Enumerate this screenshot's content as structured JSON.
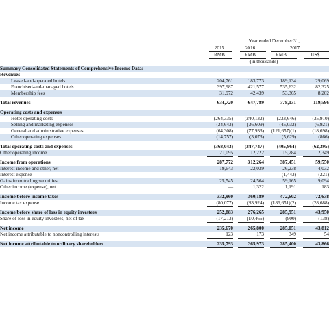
{
  "header": {
    "year_ended": "Year ended December 31,",
    "years": [
      "2015",
      "2016",
      "2017"
    ],
    "currencies": [
      "RMB",
      "RMB",
      "RMB",
      "US$"
    ],
    "units": "(in thousands)"
  },
  "rows": [
    {
      "label": "Summary Consolidated Statements of Comprehensive Income Data:",
      "bold": true
    },
    {
      "label": "Revenues",
      "bold": true
    },
    {
      "label": "Leased-and-operated hotels",
      "indent": 1,
      "values": [
        "204,761",
        "183,773",
        "189,134",
        "29,069"
      ]
    },
    {
      "label": "Franchised-and-managed hotels",
      "indent": 1,
      "values": [
        "397,987",
        "421,577",
        "535,632",
        "82,325"
      ]
    },
    {
      "label": "Membership fees",
      "indent": 1,
      "values": [
        "31,972",
        "42,439",
        "53,365",
        "8,202"
      ],
      "underline": true
    },
    {
      "label": "Total revenues",
      "bold": true,
      "values": [
        "634,720",
        "647,789",
        "778,131",
        "119,596"
      ],
      "gap": true
    },
    {
      "label": "Operating costs and expenses",
      "bold": true,
      "gap": true
    },
    {
      "label": "Hotel operating costs",
      "indent": 1,
      "values": [
        "(264,335)",
        "(240,132)",
        "(233,646)",
        "(35,910)"
      ]
    },
    {
      "label": "Selling and marketing expenses",
      "indent": 1,
      "values": [
        "(24,643)",
        "(26,609)",
        "(45,032)",
        "(6,921)"
      ]
    },
    {
      "label": "General and administrative expenses",
      "indent": 1,
      "values": [
        "(64,308)",
        "(77,933)",
        "(121,657)(1)",
        "(18,698)"
      ]
    },
    {
      "label": "Other operating expenses",
      "indent": 1,
      "values": [
        "(14,757)",
        "(3,073)",
        "(5,629)",
        "(866)"
      ],
      "underline": true
    },
    {
      "label": "Total operating costs and expenses",
      "bold": true,
      "values": [
        "(368,043)",
        "(347,747)",
        "(405,964)",
        "(62,395)"
      ],
      "gap": true
    },
    {
      "label": "Other operating income",
      "values": [
        "21,095",
        "12,222",
        "15,284",
        "2,349"
      ],
      "underline": true
    },
    {
      "label": "Income from operations",
      "bold": true,
      "values": [
        "287,772",
        "312,264",
        "387,451",
        "59,550"
      ],
      "gap": true
    },
    {
      "label": "Interest income and other, net",
      "values": [
        "19,643",
        "22,039",
        "26,238",
        "4,032"
      ]
    },
    {
      "label": "Interest expense",
      "values": [
        "—",
        "—",
        "(1,443)",
        "(221)"
      ]
    },
    {
      "label": "Gains from trading securities",
      "values": [
        "25,545",
        "24,564",
        "59,165",
        "9,094"
      ]
    },
    {
      "label": "Other income (expense), net",
      "values": [
        "—",
        "1,322",
        "1,191",
        "183"
      ],
      "underline": true
    },
    {
      "label": "Income before income taxes",
      "bold": true,
      "values": [
        "332,960",
        "360,189",
        "472,602",
        "72,638"
      ],
      "gap": true
    },
    {
      "label": "Income tax expense",
      "values": [
        "(80,077)",
        "(83,924)",
        "(186,651)(2)",
        "(28,688)"
      ],
      "underline": true
    },
    {
      "label": "Income before share of loss in equity investees",
      "bold": true,
      "values": [
        "252,883",
        "276,265",
        "285,951",
        "43,950"
      ],
      "gap": true
    },
    {
      "label": "Share of loss in equity investees, net of tax",
      "values": [
        "(17,213)",
        "(10,465)",
        "(900)",
        "(138)"
      ],
      "underline": true
    },
    {
      "label": "Net income",
      "bold": true,
      "values": [
        "235,670",
        "265,800",
        "285,051",
        "43,812"
      ],
      "gap": true
    },
    {
      "label": "Net income attributable to noncontrolling interests",
      "values": [
        "123",
        "173",
        "349",
        "54"
      ],
      "underline": true
    },
    {
      "label": "Net income attributable to ordinary shareholders",
      "bold": true,
      "values": [
        "235,793",
        "265,973",
        "285,400",
        "43,866"
      ],
      "gap": true,
      "underline": true
    }
  ]
}
